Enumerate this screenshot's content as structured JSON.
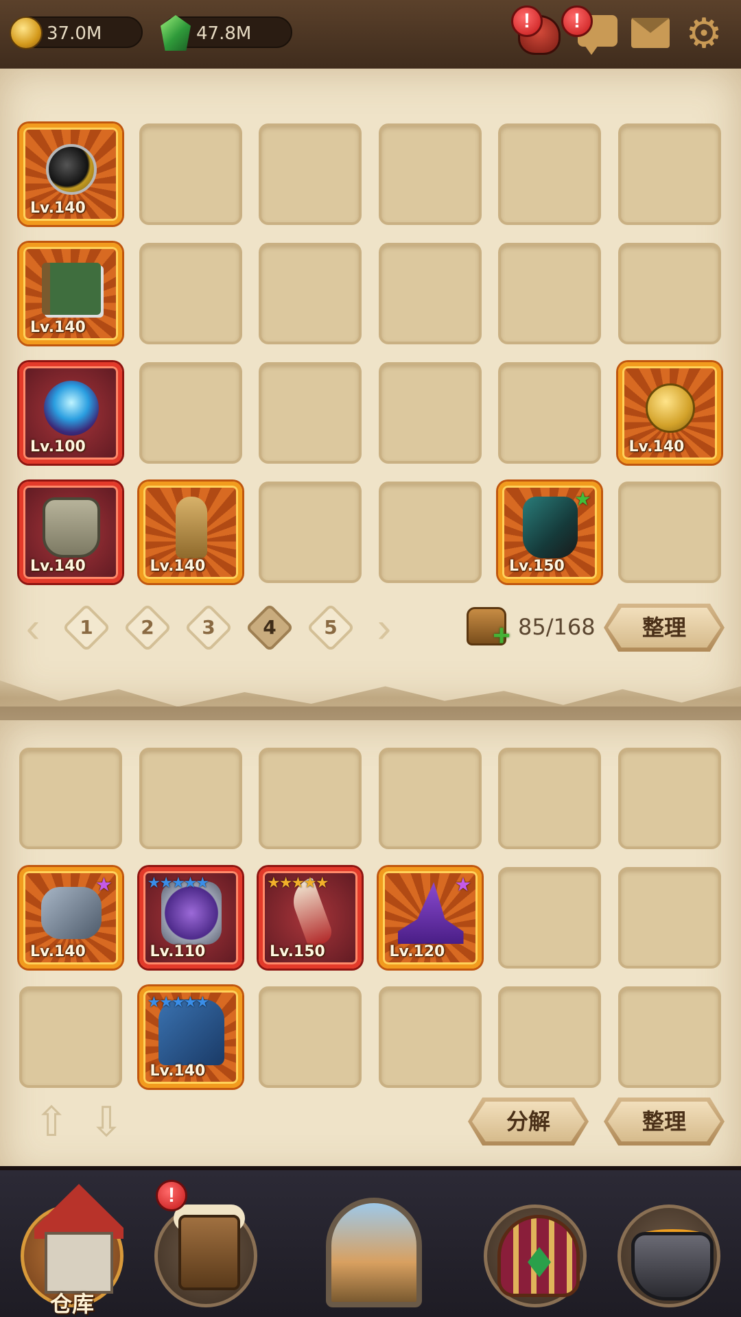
{
  "currencies": {
    "gold": "37.0M",
    "gems": "47.8M"
  },
  "header_icons": {
    "alert_symbol": "!",
    "gear_glyph": "⚙"
  },
  "inventory": {
    "top_items": [
      {
        "level": "Lv.140",
        "art": "amulet",
        "frame": "orange",
        "stars": ""
      },
      {
        "level": "Lv.140",
        "art": "book",
        "frame": "orange",
        "stars": ""
      },
      {
        "level": "Lv.100",
        "art": "orb",
        "frame": "red",
        "stars": ""
      },
      {
        "level": "Lv.140",
        "art": "medal",
        "frame": "orange",
        "stars": ""
      },
      {
        "level": "Lv.140",
        "art": "armor",
        "frame": "red",
        "stars": ""
      },
      {
        "level": "Lv.140",
        "art": "finger",
        "frame": "orange",
        "stars": ""
      },
      {
        "level": "Lv.150",
        "art": "glove",
        "frame": "orange",
        "stars": "★"
      }
    ],
    "pager": {
      "prev": "‹",
      "next": "›",
      "pages": [
        "1",
        "2",
        "3",
        "4",
        "5"
      ],
      "current_page": "4"
    },
    "capacity": "85/168",
    "sort_label": "整理"
  },
  "equipped": {
    "items": [
      {
        "level": "Lv.140",
        "art": "gauntlet",
        "frame": "orange",
        "stars": "★"
      },
      {
        "level": "Lv.110",
        "art": "purple-armor",
        "frame": "red",
        "stars": "★★★★★"
      },
      {
        "level": "Lv.150",
        "art": "claw",
        "frame": "red",
        "stars": "★★★★★"
      },
      {
        "level": "Lv.120",
        "art": "hat",
        "frame": "orange",
        "stars": "★"
      },
      {
        "level": "Lv.140",
        "art": "cloak",
        "frame": "orange",
        "stars": "★★★★★"
      }
    ],
    "decompose_label": "分解",
    "sort_label": "整理",
    "up_arrow": "⇧",
    "down_arrow": "⇩"
  },
  "bottom_nav": {
    "warehouse_label": "仓库"
  },
  "colors": {
    "parchment": "#efe3c8",
    "slot": "#dcc89e",
    "orange_frame": "#f29b1e",
    "red_frame": "#e33a2a",
    "alert_red": "#c41818"
  }
}
